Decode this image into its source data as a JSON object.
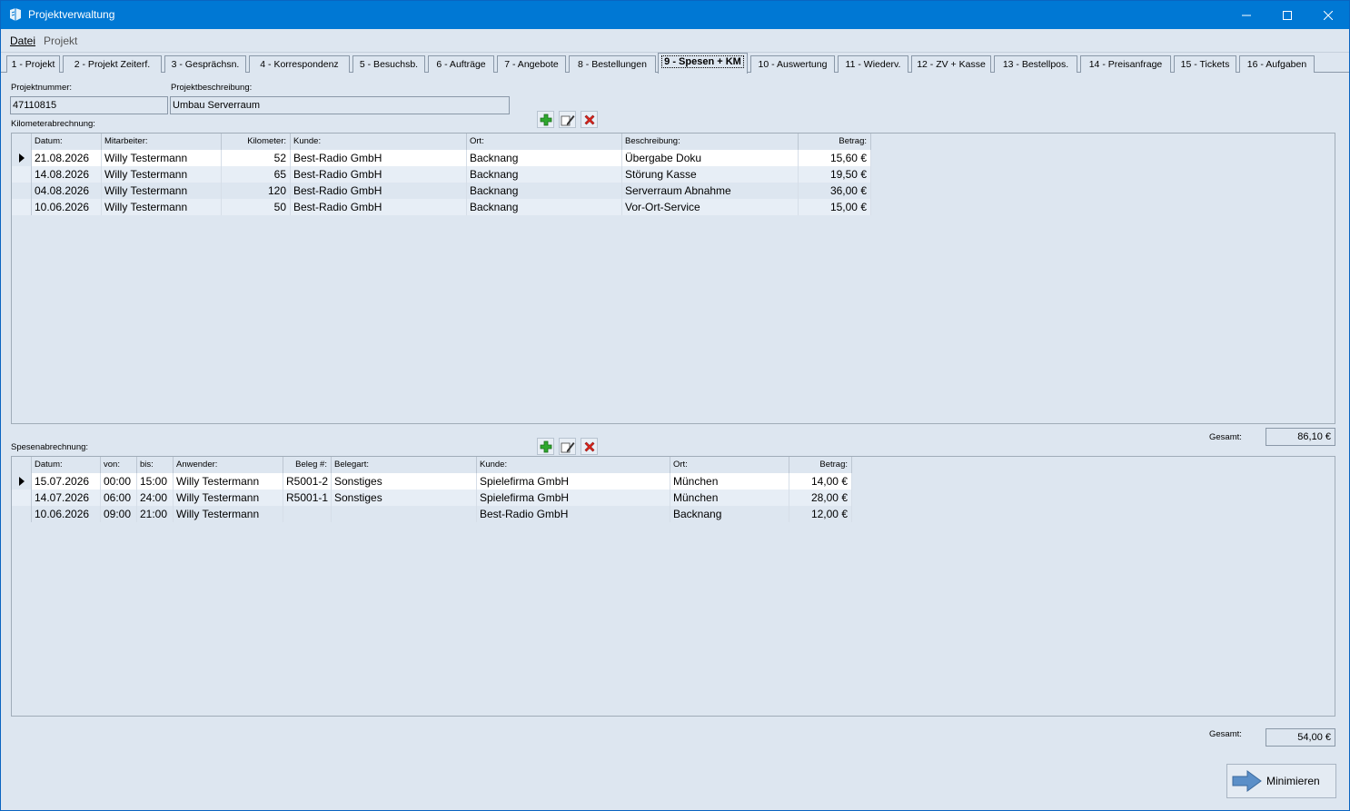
{
  "window": {
    "title": "Projektverwaltung"
  },
  "menu": [
    {
      "label": "Datei"
    },
    {
      "label": "Projekt"
    }
  ],
  "tabs": [
    {
      "label": "1 - Projekt"
    },
    {
      "label": "2 - Projekt Zeiterf."
    },
    {
      "label": "3 - Gesprächsn."
    },
    {
      "label": "4 - Korrespondenz"
    },
    {
      "label": "5 - Besuchsb."
    },
    {
      "label": "6 - Aufträge"
    },
    {
      "label": "7 - Angebote"
    },
    {
      "label": "8 - Bestellungen"
    },
    {
      "label": "9 - Spesen + KM"
    },
    {
      "label": "10 - Auswertung"
    },
    {
      "label": "11 - Wiederv."
    },
    {
      "label": "12 - ZV + Kasse"
    },
    {
      "label": "13 - Bestellpos."
    },
    {
      "label": "14 - Preisanfrage"
    },
    {
      "label": "15 - Tickets"
    },
    {
      "label": "16 - Aufgaben"
    }
  ],
  "project": {
    "number_label": "Projektnummer:",
    "number": "47110815",
    "description_label": "Projektbeschreibung:",
    "description": "Umbau Serverraum"
  },
  "km": {
    "section_label": "Kilometerabrechnung:",
    "columns": [
      "Datum:",
      "Mitarbeiter:",
      "Kilometer:",
      "Kunde:",
      "Ort:",
      "Beschreibung:",
      "Betrag:"
    ],
    "rows": [
      [
        "21.08.2026",
        "Willy Testermann",
        "52",
        "Best-Radio GmbH",
        "Backnang",
        "Übergabe Doku",
        "15,60 €"
      ],
      [
        "14.08.2026",
        "Willy Testermann",
        "65",
        "Best-Radio GmbH",
        "Backnang",
        "Störung Kasse",
        "19,50 €"
      ],
      [
        "04.08.2026",
        "Willy Testermann",
        "120",
        "Best-Radio GmbH",
        "Backnang",
        "Serverraum Abnahme",
        "36,00 €"
      ],
      [
        "10.06.2026",
        "Willy Testermann",
        "50",
        "Best-Radio GmbH",
        "Backnang",
        "Vor-Ort-Service",
        "15,00 €"
      ]
    ],
    "total_label": "Gesamt:",
    "total": "86,10 €"
  },
  "spesen": {
    "section_label": "Spesenabrechnung:",
    "columns": [
      "Datum:",
      "von:",
      "bis:",
      "Anwender:",
      "Beleg #:",
      "Belegart:",
      "Kunde:",
      "Ort:",
      "Betrag:"
    ],
    "rows": [
      [
        "15.07.2026",
        "00:00",
        "15:00",
        "Willy Testermann",
        "R5001-2",
        "Sonstiges",
        "Spielefirma GmbH",
        "München",
        "14,00 €"
      ],
      [
        "14.07.2026",
        "06:00",
        "24:00",
        "Willy Testermann",
        "R5001-1",
        "Sonstiges",
        "Spielefirma GmbH",
        "München",
        "28,00 €"
      ],
      [
        "10.06.2026",
        "09:00",
        "21:00",
        "Willy Testermann",
        "",
        "",
        "Best-Radio GmbH",
        "Backnang",
        "12,00 €"
      ]
    ],
    "total_label": "Gesamt:",
    "total": "54,00 €"
  },
  "buttons": {
    "minimize_label": "Minimieren"
  },
  "icons": {
    "add": "plus-icon",
    "edit": "edit-icon",
    "delete": "delete-icon",
    "window_min": "minimize-icon",
    "window_max": "maximize-icon",
    "window_close": "close-icon",
    "minimize_arrow": "arrow-right-icon"
  },
  "colors": {
    "titlebar": "#0078d4",
    "background": "#dde6f0",
    "row_selected": "#ffffff",
    "row_alt": "#e7eef6"
  }
}
